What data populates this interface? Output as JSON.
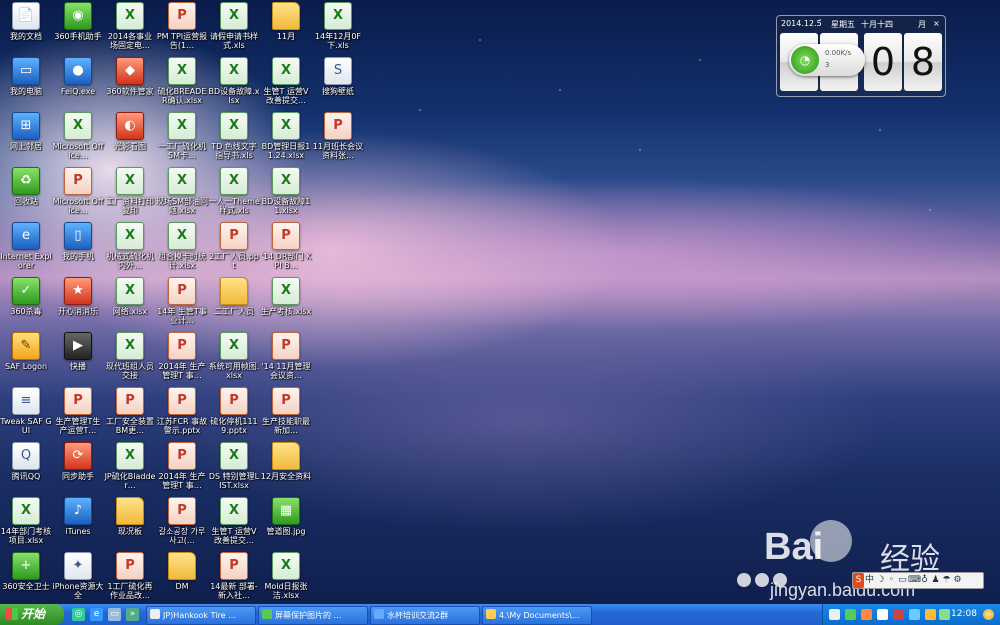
{
  "desktop": {
    "icons": [
      {
        "label": "我的文档",
        "type": "white",
        "glyph": "📄"
      },
      {
        "label": "360手机助手",
        "type": "green",
        "glyph": "◉"
      },
      {
        "label": "2014各事业场固定电…",
        "type": "xls",
        "glyph": "X"
      },
      {
        "label": "PM TPI运营报告(1…",
        "type": "ppt",
        "glyph": "P"
      },
      {
        "label": "请假申请书样式.xls",
        "type": "xls",
        "glyph": "X"
      },
      {
        "label": "11月",
        "type": "folder",
        "glyph": ""
      },
      {
        "label": "14年12月0F下.xls",
        "type": "xls",
        "glyph": "X"
      },
      {
        "label": "我的电脑",
        "type": "app",
        "glyph": "▭"
      },
      {
        "label": "FeiQ.exe",
        "type": "app",
        "glyph": "●"
      },
      {
        "label": "360软件管家",
        "type": "red",
        "glyph": "◆"
      },
      {
        "label": "硫化BREADER确认.xlsx",
        "type": "xls",
        "glyph": "X"
      },
      {
        "label": "BD设备故障.xlsx",
        "type": "xls",
        "glyph": "X"
      },
      {
        "label": "生管T 运营V改善提交…",
        "type": "xls",
        "glyph": "X"
      },
      {
        "label": "搜狗壁纸",
        "type": "white",
        "glyph": "S"
      },
      {
        "label": "网上邻居",
        "type": "app",
        "glyph": "⊞"
      },
      {
        "label": "Microsoft Office…",
        "type": "xls",
        "glyph": "X"
      },
      {
        "label": "光影看图",
        "type": "red",
        "glyph": "◐"
      },
      {
        "label": "一工厂硫化机SM卡…",
        "type": "xls",
        "glyph": "X"
      },
      {
        "label": "TD 色线文字指导书.xls",
        "type": "xls",
        "glyph": "X"
      },
      {
        "label": "BD管理日报11.24.xlsx",
        "type": "xls",
        "glyph": "X"
      },
      {
        "label": "11月班长会议资料张…",
        "type": "ppt",
        "glyph": "P"
      },
      {
        "label": "回收站",
        "type": "green",
        "glyph": "♻"
      },
      {
        "label": "Microsoft Office…",
        "type": "ppt",
        "glyph": "P"
      },
      {
        "label": "工厂资料打印复印",
        "type": "xls",
        "glyph": "X"
      },
      {
        "label": "现场SM部油问题.xlsx",
        "type": "xls",
        "glyph": "X"
      },
      {
        "label": "一人一Theme样式.xls",
        "type": "xls",
        "glyph": "X"
      },
      {
        "label": "BD设备故障11.xlsx",
        "type": "xls",
        "glyph": "X"
      },
      {
        "label": "Internet Explorer",
        "type": "app",
        "glyph": "e"
      },
      {
        "label": "我的手机",
        "type": "app",
        "glyph": "▯"
      },
      {
        "label": "机械式硫化机内外…",
        "type": "xls",
        "glyph": "X"
      },
      {
        "label": "组合模卡时统计.xlsx",
        "type": "xls",
        "glyph": "X"
      },
      {
        "label": "2工厂人员.ppt",
        "type": "ppt",
        "glyph": "P"
      },
      {
        "label": "'14 DR部门 KPI B…",
        "type": "ppt",
        "glyph": "P"
      },
      {
        "label": "360杀毒",
        "type": "green",
        "glyph": "✓"
      },
      {
        "label": "开心消消乐",
        "type": "red",
        "glyph": "★"
      },
      {
        "label": "网络.xlsx",
        "type": "xls",
        "glyph": "X"
      },
      {
        "label": "14年 生管T事业计…",
        "type": "ppt",
        "glyph": "P"
      },
      {
        "label": "二工厂人员",
        "type": "folder",
        "glyph": ""
      },
      {
        "label": "生产考核.xlsx",
        "type": "xls",
        "glyph": "X"
      },
      {
        "label": "SAF Logon",
        "type": "yellow",
        "glyph": "✎"
      },
      {
        "label": "快播",
        "type": "dark",
        "glyph": "▶"
      },
      {
        "label": "现代班组人员交接",
        "type": "xls",
        "glyph": "X"
      },
      {
        "label": "2014年 生产管理T 事…",
        "type": "ppt",
        "glyph": "P"
      },
      {
        "label": "系统可用帧图.xlsx",
        "type": "xls",
        "glyph": "X"
      },
      {
        "label": "'14 11月管理会议资…",
        "type": "ppt",
        "glyph": "P"
      },
      {
        "label": "Tweak SAF GUI",
        "type": "white",
        "glyph": "≡"
      },
      {
        "label": "生产管理T生产运营T…",
        "type": "ppt",
        "glyph": "P"
      },
      {
        "label": "工厂安全装置BM更…",
        "type": "ppt",
        "glyph": "P"
      },
      {
        "label": "江苏FCR 事故警示.pptx",
        "type": "ppt",
        "glyph": "P"
      },
      {
        "label": "硫化停机1119.pptx",
        "type": "ppt",
        "glyph": "P"
      },
      {
        "label": "生产技能职最新加…",
        "type": "ppt",
        "glyph": "P"
      },
      {
        "label": "腾讯QQ",
        "type": "white",
        "glyph": "Q"
      },
      {
        "label": "同步助手",
        "type": "red",
        "glyph": "⟳"
      },
      {
        "label": "JP硫化Bladder…",
        "type": "xls",
        "glyph": "X"
      },
      {
        "label": "2014年 生产管理T 事…",
        "type": "ppt",
        "glyph": "P"
      },
      {
        "label": "DS 特别管理LIST.xlsx",
        "type": "xls",
        "glyph": "X"
      },
      {
        "label": "12月安全资料",
        "type": "folder",
        "glyph": ""
      },
      {
        "label": "14年部门考核项目.xlsx",
        "type": "xls",
        "glyph": "X"
      },
      {
        "label": "iTunes",
        "type": "app",
        "glyph": "♪"
      },
      {
        "label": "现况板",
        "type": "folder",
        "glyph": ""
      },
      {
        "label": "갈소공장 가루 사고(…",
        "type": "ppt",
        "glyph": "P"
      },
      {
        "label": "生管T 运营V改善提交…",
        "type": "xls",
        "glyph": "X"
      },
      {
        "label": "管道图.jpg",
        "type": "green",
        "glyph": "▦"
      },
      {
        "label": "360安全卫士",
        "type": "green",
        "glyph": "+"
      },
      {
        "label": "iPhone资源大全",
        "type": "white",
        "glyph": "✦"
      },
      {
        "label": "1工厂硫化再作业品改…",
        "type": "ppt",
        "glyph": "P"
      },
      {
        "label": "DM",
        "type": "folder",
        "glyph": ""
      },
      {
        "label": "14最新 部署-新入社…",
        "type": "ppt",
        "glyph": "P"
      },
      {
        "label": "Mold日报张洁.xlsx",
        "type": "xls",
        "glyph": "X"
      }
    ]
  },
  "gadget": {
    "date": "2014.12.5",
    "weekday": "星期五",
    "lunar": "十月十四",
    "month_btn": "月",
    "close": "×",
    "digits": [
      "",
      "",
      "0",
      "8"
    ],
    "net_up": "0.00K/s",
    "net_down": "3"
  },
  "watermark": {
    "brand": "Bai",
    "cn": "经验",
    "url": "jingyan.baidu.com"
  },
  "ime": {
    "items": [
      "S",
      "中",
      "☽",
      "◦",
      "▭",
      "⌨",
      "♁",
      "♟",
      "☂",
      "⚙"
    ]
  },
  "taskbar": {
    "start": "开始",
    "tasks": [
      {
        "label": "JP)Hankook Tire …"
      },
      {
        "label": "屏幕保护图片的 …"
      },
      {
        "label": "水杯培训交流2群"
      },
      {
        "label": "4.\\My Documents\\…"
      }
    ],
    "clock": "12:08"
  },
  "colors": {
    "taskbar": "#2469d6",
    "start": "#3c9c30"
  }
}
